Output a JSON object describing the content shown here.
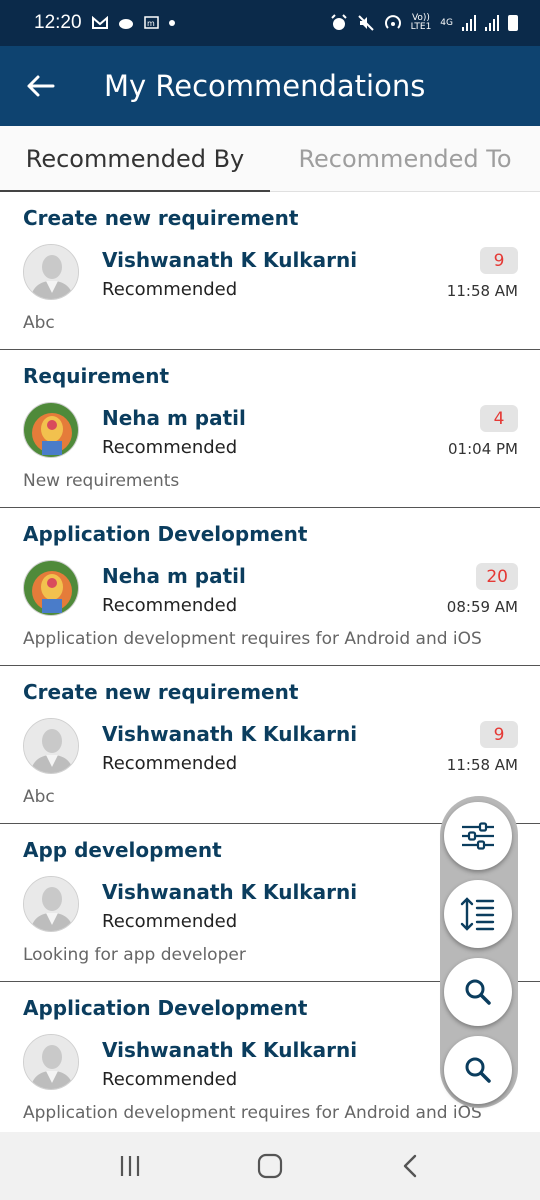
{
  "status_bar": {
    "time": "12:20",
    "net_label": "LTE1",
    "net_gen": "4G",
    "volte": "Vo))"
  },
  "app_bar": {
    "title": "My Recommendations"
  },
  "tabs": [
    {
      "label": "Recommended By",
      "active": true
    },
    {
      "label": "Recommended To",
      "active": false
    }
  ],
  "cards": [
    {
      "title": "Create new requirement",
      "name": "Vishwanath K Kulkarni",
      "status": "Recommended",
      "count": "9",
      "time": "11:58 AM",
      "desc": "Abc",
      "avatar": "default-avatar"
    },
    {
      "title": "Requirement",
      "name": "Neha m patil",
      "status": "Recommended",
      "count": "4",
      "time": "01:04 PM",
      "desc": "New requirements",
      "avatar": "photo-avatar"
    },
    {
      "title": "Application Development",
      "name": "Neha m patil",
      "status": "Recommended",
      "count": "20",
      "time": "08:59 AM",
      "desc": "Application development requires for Android and iOS",
      "avatar": "photo-avatar"
    },
    {
      "title": "Create new requirement",
      "name": "Vishwanath K Kulkarni",
      "status": "Recommended",
      "count": "9",
      "time": "11:58 AM",
      "desc": "Abc",
      "avatar": "default-avatar"
    },
    {
      "title": "App development",
      "name": "Vishwanath K Kulkarni",
      "status": "Recommended",
      "count": "",
      "time": "",
      "desc": "Looking for app developer",
      "avatar": "default-avatar"
    },
    {
      "title": "Application Development",
      "name": "Vishwanath K Kulkarni",
      "status": "Recommended",
      "count": "",
      "time": "",
      "desc": "Application development requires for Android and iOS",
      "avatar": "default-avatar"
    }
  ],
  "fabs": [
    "filter-icon",
    "sort-icon",
    "search-icon",
    "search-icon"
  ],
  "colors": {
    "status_bar": "#0b2a4a",
    "app_bar": "#0e4370",
    "title_text": "#0b3d5e",
    "badge_text": "#e53935"
  }
}
